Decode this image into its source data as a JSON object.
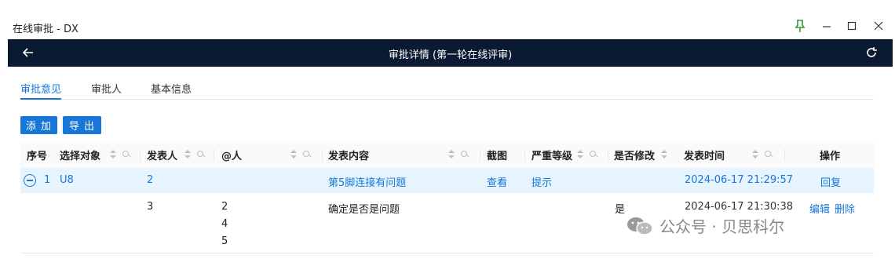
{
  "window": {
    "title": "在线审批 - DX"
  },
  "navbar": {
    "title": "审批详情 (第一轮在线评审)"
  },
  "tabs": [
    "审批意见",
    "审批人",
    "基本信息"
  ],
  "toolbar": {
    "add_label": "添 加",
    "export_label": "导 出"
  },
  "table": {
    "columns": [
      "序号",
      "选择对象",
      "发表人",
      "@人",
      "发表内容",
      "截图",
      "严重等级",
      "是否修改",
      "发表时间",
      "操作"
    ],
    "rows": [
      {
        "index": "1",
        "target": "U8",
        "author": "2",
        "mentions": "",
        "content": "第5脚连接有问题",
        "screenshot": "查看",
        "severity": "提示",
        "modified": "",
        "time": "2024-06-17 21:29:57",
        "actions": [
          "回复"
        ]
      },
      {
        "index": "",
        "target": "",
        "author": "3",
        "mentions": [
          "2",
          "4",
          "5"
        ],
        "content": "确定是否是问题",
        "screenshot": "",
        "severity": "",
        "modified": "是",
        "time": "2024-06-17 21:30:38",
        "actions": [
          "编辑",
          "删除"
        ]
      }
    ]
  },
  "watermark": {
    "text": "公众号 · 贝思科尔"
  },
  "colors": {
    "primary": "#1677d8",
    "navbar": "#0a1a33",
    "selected_row": "#e6f4ff",
    "pin": "#2e9d3a"
  }
}
